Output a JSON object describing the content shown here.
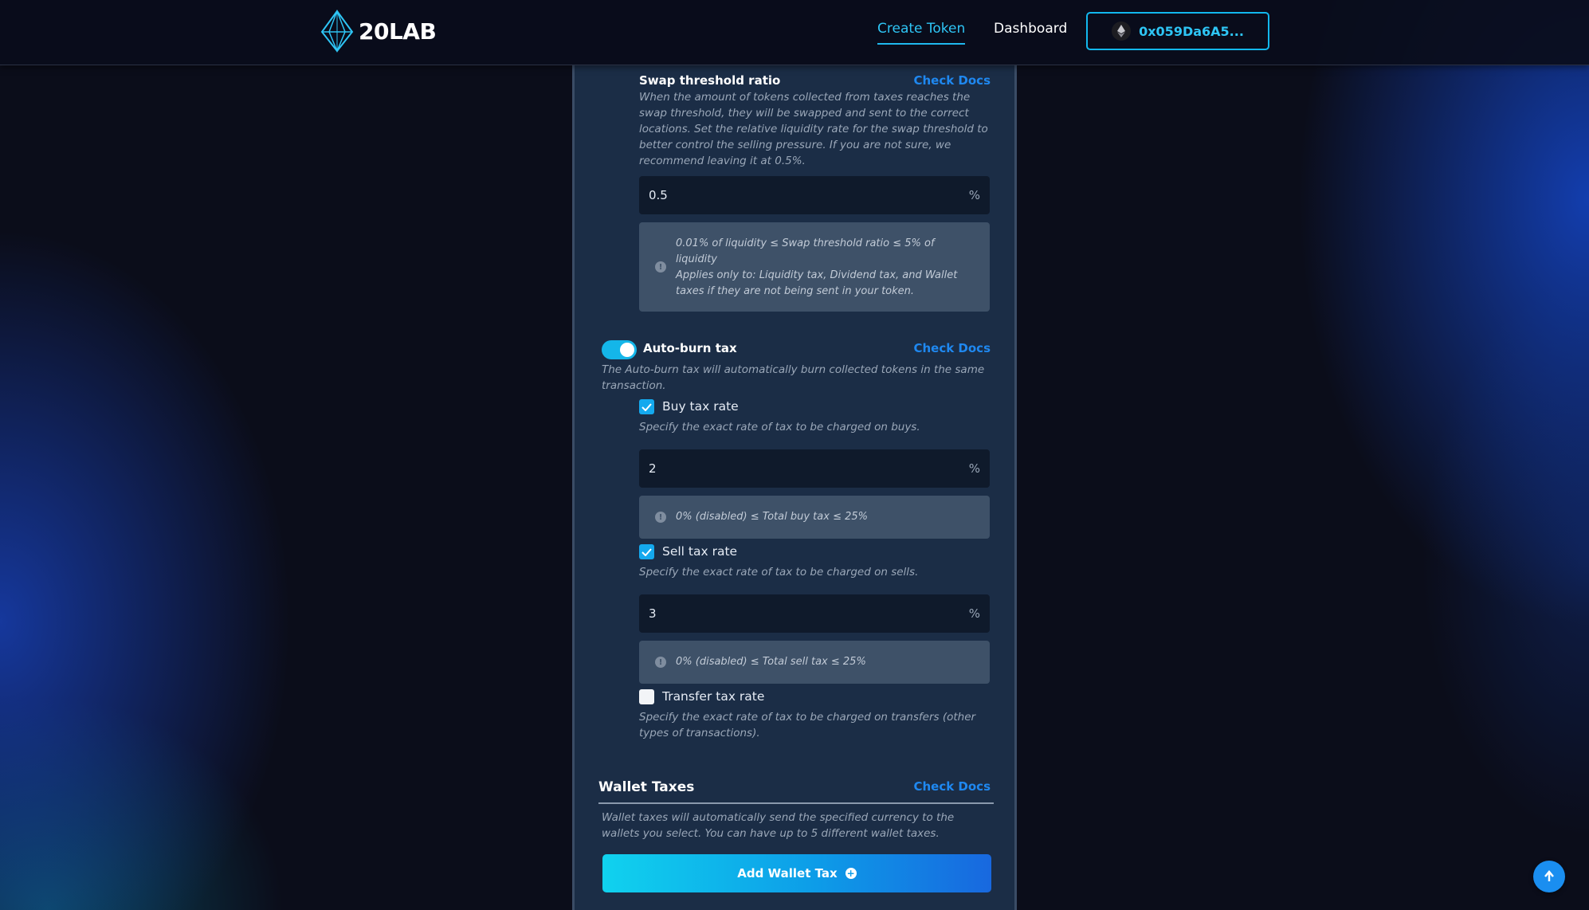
{
  "header": {
    "logo_text": "20LAB",
    "nav": {
      "create_token": "Create Token",
      "dashboard": "Dashboard"
    },
    "wallet_address": "0x059Da6A5..."
  },
  "swap_threshold": {
    "title": "Swap threshold ratio",
    "docs": "Check Docs",
    "description": "When the amount of tokens collected from taxes reaches the swap threshold, they will be swapped and sent to the correct locations. Set the relative liquidity rate for the swap threshold to better control the selling pressure. If you are not sure, we recommend leaving it at 0.5%.",
    "value": "0.5",
    "unit": "%",
    "info_line1": "0.01% of liquidity ≤ Swap threshold ratio ≤ 5% of liquidity",
    "info_line2": "Applies only to: Liquidity tax, Dividend tax, and Wallet taxes if they are not being sent in your token."
  },
  "auto_burn": {
    "title": "Auto-burn tax",
    "docs": "Check Docs",
    "enabled": true,
    "description": "The Auto-burn tax will automatically burn collected tokens in the same transaction.",
    "buy": {
      "label": "Buy tax rate",
      "checked": true,
      "description": "Specify the exact rate of tax to be charged on buys.",
      "value": "2",
      "unit": "%",
      "info": "0% (disabled) ≤ Total buy tax ≤ 25%"
    },
    "sell": {
      "label": "Sell tax rate",
      "checked": true,
      "description": "Specify the exact rate of tax to be charged on sells.",
      "value": "3",
      "unit": "%",
      "info": "0% (disabled) ≤ Total sell tax ≤ 25%"
    },
    "transfer": {
      "label": "Transfer tax rate",
      "checked": false,
      "description": "Specify the exact rate of tax to be charged on transfers (other types of transactions)."
    }
  },
  "wallet_taxes": {
    "title": "Wallet Taxes",
    "docs": "Check Docs",
    "description": "Wallet taxes will automatically send the specified currency to the wallets you select. You can have up to 5 different wallet taxes.",
    "add_button": "Add Wallet Tax"
  },
  "colors": {
    "accent": "#14b6e9",
    "link": "#1f88f0",
    "panel": "#1b2d46"
  }
}
